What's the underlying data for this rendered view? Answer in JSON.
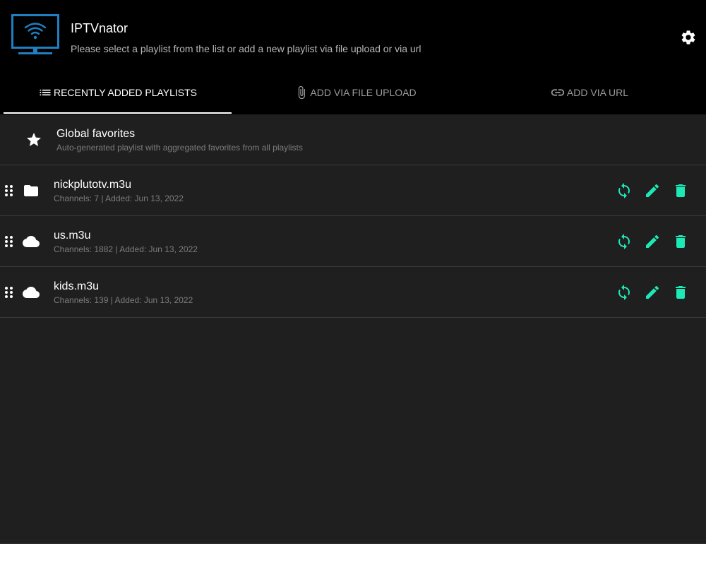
{
  "app": {
    "title": "IPTVnator",
    "subtitle": "Please select a playlist from the list or add a new playlist via file upload or via url"
  },
  "colors": {
    "accent": "#1de9b6",
    "logo": "#1f7fc2",
    "background": "#1f1f1f",
    "header": "#000000"
  },
  "tabs": [
    {
      "label": "RECENTLY ADDED PLAYLISTS",
      "icon": "list-icon",
      "active": true
    },
    {
      "label": "ADD VIA FILE UPLOAD",
      "icon": "paperclip-icon",
      "active": false
    },
    {
      "label": "ADD VIA URL",
      "icon": "link-icon",
      "active": false
    }
  ],
  "favorites": {
    "title": "Global favorites",
    "description": "Auto-generated playlist with aggregated favorites from all playlists",
    "icon": "star-icon"
  },
  "playlists": [
    {
      "title": "nickplutotv.m3u",
      "meta": "Channels: 7 | Added: Jun 13, 2022",
      "icon": "folder-icon"
    },
    {
      "title": "us.m3u",
      "meta": "Channels: 1882 | Added: Jun 13, 2022",
      "icon": "cloud-icon"
    },
    {
      "title": "kids.m3u",
      "meta": "Channels: 139 | Added: Jun 13, 2022",
      "icon": "cloud-icon"
    }
  ],
  "actions": [
    "refresh-icon",
    "edit-icon",
    "delete-icon"
  ]
}
